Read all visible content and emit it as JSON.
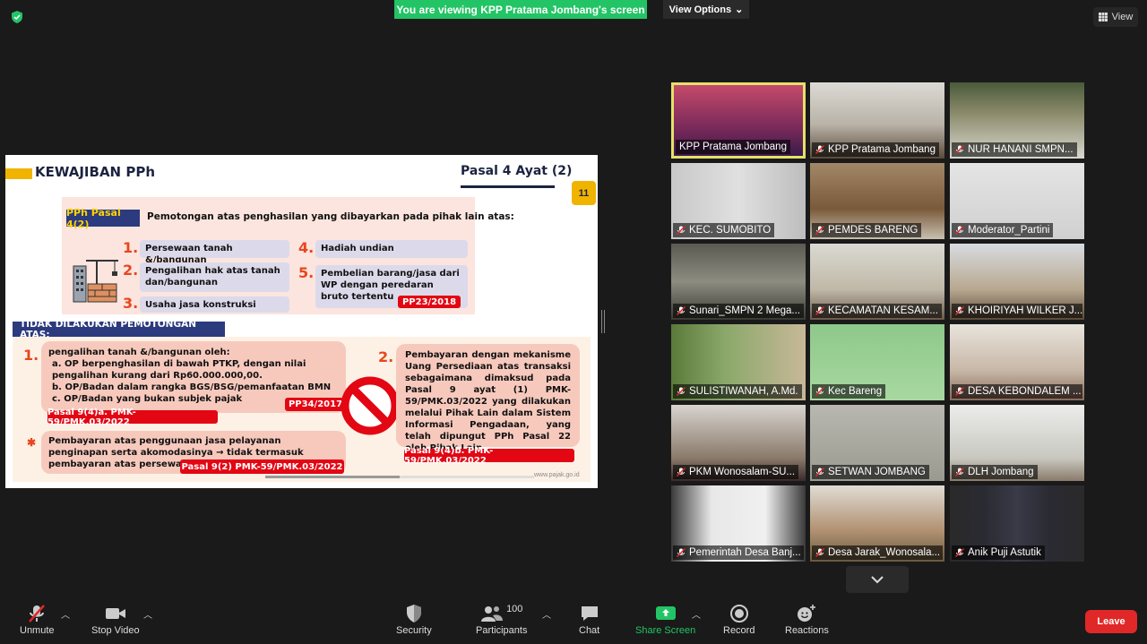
{
  "banner": {
    "viewing_text": "You are viewing KPP Pratama Jombang's screen",
    "view_options_label": "View Options",
    "view_label": "View"
  },
  "slide": {
    "title": "KEWAJIBAN PPh",
    "pasal": "Pasal 4 Ayat (2)",
    "page_number": "11",
    "pph_tag": "PPh Pasal 4(2)",
    "pph_desc": "Pemotongan atas penghasilan yang dibayarkan pada pihak lain atas:",
    "items": [
      {
        "num": "1.",
        "text": "Persewaan tanah &/bangunan"
      },
      {
        "num": "2.",
        "text": "Pengalihan hak atas tanah dan/bangunan"
      },
      {
        "num": "3.",
        "text": "Usaha jasa konstruksi"
      },
      {
        "num": "4.",
        "text": "Hadiah undian"
      },
      {
        "num": "5.",
        "text": "Pembelian barang/jasa dari WP dengan peredaran bruto tertentu"
      }
    ],
    "pp23_tag": "PP23/2018",
    "tidak_title": "TIDAK DILAKUKAN PEMOTONGAN ATAS:",
    "lower1_num": "1.",
    "lower1_head": "pengalihan tanah &/bangunan oleh:",
    "lower1_a": "a.  OP berpenghasilan di bawah PTKP, dengan nilai pengalihan kurang dari Rp60.000.000,00.",
    "lower1_b": "b.  OP/Badan dalam rangka BGS/BSG/pemanfaatan BMN",
    "lower1_c": "c.  OP/Badan yang bukan subjek pajak",
    "pp34_tag": "PP34/2017",
    "tag_9_4a": "Pasal 9(4)a. PMK-59/PMK.03/2022",
    "bullet_text": "Pembayaran atas penggunaan jasa pelayanan penginapan serta akomodasinya → tidak termasuk pembayaran atas persewaan tanah dan/atau bangunan.",
    "tag_9_2": "Pasal 9(2) PMK-59/PMK.03/2022",
    "lower2_num": "2.",
    "lower2_text": "Pembayaran dengan mekanisme Uang Persediaan atas transaksi sebagaimana dimaksud pada Pasal 9 ayat (1) PMK-59/PMK.03/2022 yang dilakukan melalui Pihak Lain dalam Sistem Informasi Pengadaan, yang telah dipungut PPh Pasal 22 oleh Pihak Lain",
    "tag_9_4b": "Pasal 9(4)b. PMK-59/PMK.03/2022",
    "website": "www.pajak.go.id"
  },
  "participants_grid": [
    {
      "name": "KPP Pratama Jombang",
      "active": true
    },
    {
      "name": "KPP Pratama Jombang"
    },
    {
      "name": "NUR HANANI  SMPN..."
    },
    {
      "name": "KEC. SUMOBITO"
    },
    {
      "name": "PEMDES BARENG"
    },
    {
      "name": "Moderator_Partini"
    },
    {
      "name": "Sunari_SMPN 2 Mega..."
    },
    {
      "name": "KECAMATAN KESAM..."
    },
    {
      "name": "KHOIRIYAH WILKER J..."
    },
    {
      "name": "SULISTIWANAH, A.Md."
    },
    {
      "name": "Kec Bareng"
    },
    {
      "name": "DESA KEBONDALEM ..."
    },
    {
      "name": "PKM Wonosalam-SU..."
    },
    {
      "name": "SETWAN JOMBANG"
    },
    {
      "name": "DLH Jombang"
    },
    {
      "name": "Pemerintah Desa Banj..."
    },
    {
      "name": "Desa Jarak_Wonosala..."
    },
    {
      "name": "Anik Puji Astutik"
    }
  ],
  "toolbar": {
    "unmute": "Unmute",
    "stop_video": "Stop Video",
    "security": "Security",
    "participants": "Participants",
    "participants_count": "100",
    "chat": "Chat",
    "share_screen": "Share Screen",
    "record": "Record",
    "reactions": "Reactions",
    "leave": "Leave"
  },
  "colors": {
    "share_green": "#23c465",
    "leave_red": "#e02828",
    "active_speaker": "#e6e06a"
  }
}
